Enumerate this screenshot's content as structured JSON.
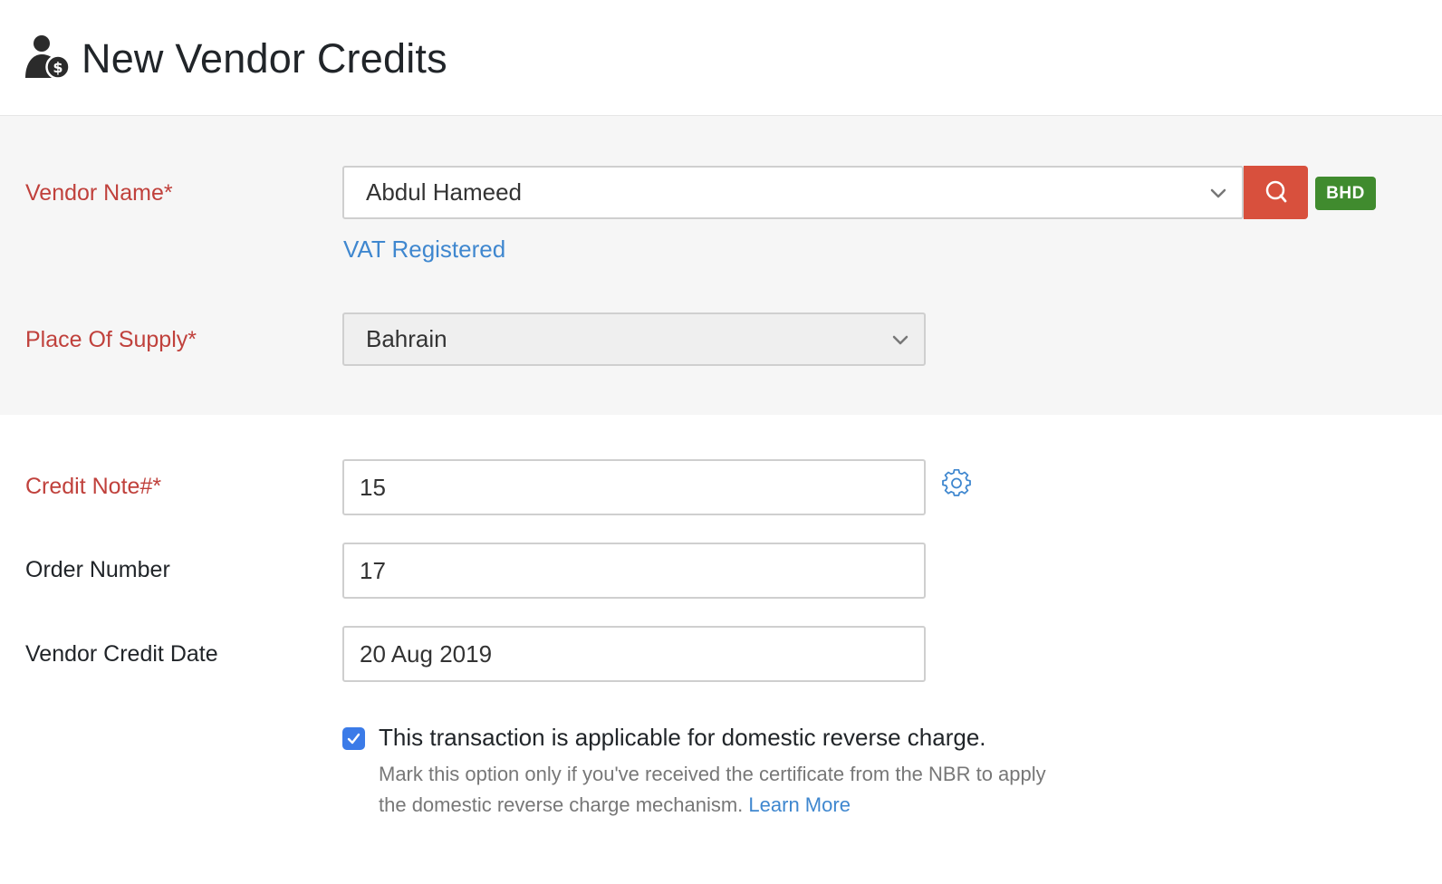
{
  "header": {
    "title": "New Vendor Credits",
    "icon": "vendor-credits-icon"
  },
  "vendor": {
    "label": "Vendor Name*",
    "value": "Abdul Hameed",
    "search_icon": "search-icon",
    "currency": "BHD",
    "vat_status": "VAT Registered"
  },
  "place_of_supply": {
    "label": "Place Of Supply*",
    "value": "Bahrain"
  },
  "credit_note": {
    "label": "Credit Note#*",
    "value": "15",
    "settings_icon": "gear-icon"
  },
  "order_number": {
    "label": "Order Number",
    "value": "17"
  },
  "vendor_credit_date": {
    "label": "Vendor Credit Date",
    "value": "20 Aug 2019"
  },
  "reverse_charge": {
    "checked": true,
    "label": "This transaction is applicable for domestic reverse charge.",
    "help_text": "Mark this option only if you've received the certificate from the NBR to apply the domestic reverse charge mechanism.",
    "learn_more": "Learn More"
  },
  "colors": {
    "required_label": "#c0413c",
    "search_button": "#d8503d",
    "currency_badge": "#408b2e",
    "link": "#3f87cf",
    "checkbox": "#3b7be8",
    "section_bg": "#f6f6f6"
  }
}
